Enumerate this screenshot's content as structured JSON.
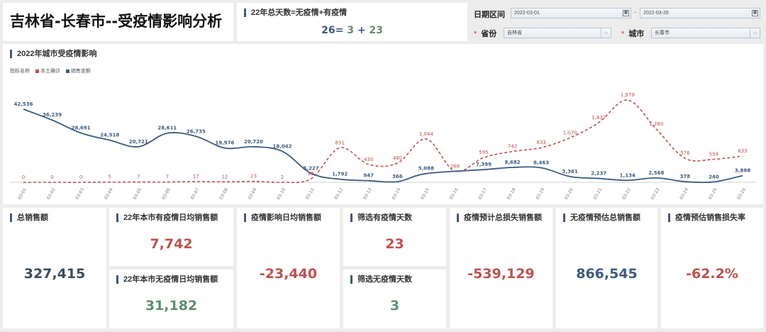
{
  "header": {
    "title": "吉林省-长春市--受疫情影响分析"
  },
  "days": {
    "label": "22年总天数=无疫情+有疫情",
    "total": "26",
    "eq": "=",
    "no_covid": "3",
    "plus": "+",
    "covid": "23"
  },
  "filters": {
    "date_label": "日期区间",
    "date_start": "2022-03-01",
    "date_sep": "-",
    "date_end": "2022-03-26",
    "province_label": "省份",
    "province_value": "吉林省",
    "city_label": "城市",
    "city_value": "长春市",
    "required_mark": "*"
  },
  "chart_panel": {
    "title": "2022年城市受疫情影响",
    "legend_prefix": "指标名称",
    "legend_cases": "本土确诊",
    "legend_sales": "销售金额"
  },
  "colors": {
    "cases": "#c0504d",
    "sales": "#3d5a80",
    "positive": "#5b8f6b",
    "negative": "#c0504d"
  },
  "chart_data": {
    "type": "line",
    "x": [
      "03-01",
      "03-02",
      "03-03",
      "03-04",
      "03-05",
      "03-06",
      "03-07",
      "03-08",
      "03-09",
      "03-10",
      "03-11",
      "03-12",
      "03-13",
      "03-14",
      "03-15",
      "03-16",
      "03-17",
      "03-18",
      "03-19",
      "03-20",
      "03-21",
      "03-22",
      "03-23",
      "03-24",
      "03-25",
      "03-26"
    ],
    "series": [
      {
        "name": "本土确诊",
        "style": "dashed",
        "values": [
          0,
          0,
          0,
          5,
          7,
          7,
          17,
          12,
          23,
          2,
          85,
          831,
          430,
          460,
          1044,
          268,
          595,
          742,
          833,
          1070,
          1437,
          1979,
          1280,
          576,
          554,
          633
        ],
        "labels": [
          "0",
          "0",
          "0",
          "5",
          "7",
          "7",
          "17",
          "12",
          "23",
          "2",
          "85",
          "831",
          "430",
          "460",
          "1,044",
          "268",
          "595",
          "742",
          "833",
          "1,070",
          "1,437",
          "1,979",
          "1,280",
          "576",
          "554",
          "633"
        ]
      },
      {
        "name": "销售金额",
        "style": "solid",
        "values": [
          42536,
          36239,
          28691,
          24518,
          20721,
          28611,
          26735,
          19976,
          20720,
          18042,
          5227,
          1792,
          947,
          366,
          5088,
          7399,
          8682,
          8463,
          3361,
          2237,
          1134,
          2568,
          378,
          240,
          3888
        ],
        "labels": [
          "42,536",
          "36,239",
          "28,691",
          "24,518",
          "20,721",
          "28,611",
          "26,735",
          "19,976",
          "20,720",
          "18,042",
          "5,227",
          "1,792",
          "947",
          "366",
          "5,088",
          "7,399",
          "8,682",
          "8,463",
          "3,361",
          "2,237",
          "1,134",
          "2,568",
          "378",
          "240",
          "3,888"
        ],
        "label_at": [
          0,
          1,
          2,
          3,
          4,
          5,
          6,
          7,
          8,
          9,
          10,
          11,
          12,
          13,
          14,
          16,
          17,
          18,
          19,
          20,
          21,
          22,
          23,
          24,
          25
        ]
      }
    ]
  },
  "kpis": {
    "total_sales_label": "总销售额",
    "total_sales": "327,415",
    "covid_daily_label": "22年本市有疫情日均销售额",
    "covid_daily": "7,742",
    "no_covid_daily_label": "22年本市无疫情日均销售额",
    "no_covid_daily": "31,182",
    "impact_daily_label": "疫情影响日均销售额",
    "impact_daily": "-23,440",
    "covid_days_label": "筛选有疫情天数",
    "covid_days": "23",
    "no_covid_days_label": "筛选无疫情天数",
    "no_covid_days": "3",
    "est_loss_label": "疫情预计总损失销售额",
    "est_loss": "-539,129",
    "est_no_covid_label": "无疫情预估总销售额",
    "est_no_covid": "866,545",
    "loss_rate_label": "疫情预估销售损失率",
    "loss_rate": "-62.2%"
  }
}
